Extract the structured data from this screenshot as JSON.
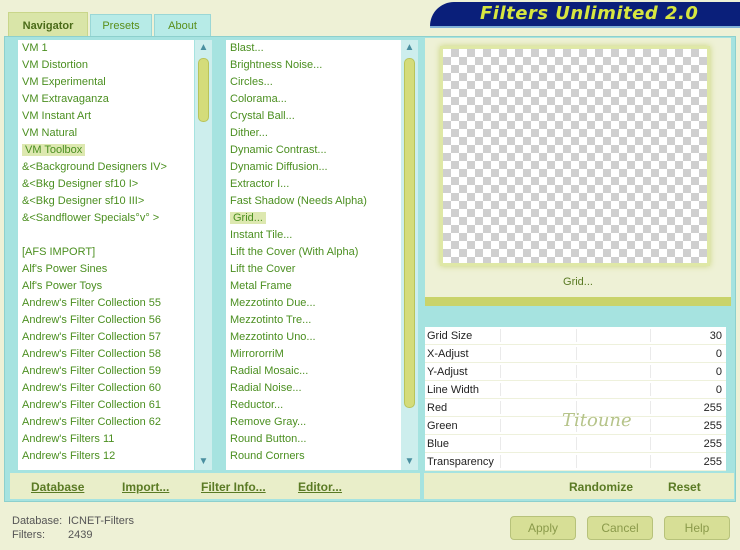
{
  "tabs": [
    {
      "label": "Navigator"
    },
    {
      "label": "Presets"
    },
    {
      "label": "About"
    }
  ],
  "banner": {
    "title": "Filters Unlimited 2.0"
  },
  "categories": {
    "selected_index": 6,
    "items": [
      "VM 1",
      "VM Distortion",
      "VM Experimental",
      "VM Extravaganza",
      "VM Instant Art",
      "VM Natural",
      "VM Toolbox",
      "&<Background Designers IV>",
      "&<Bkg Designer sf10 I>",
      "&<Bkg Designer sf10 III>",
      "&<Sandflower Specials°v° >",
      "",
      "[AFS IMPORT]",
      "Alf's Power Sines",
      "Alf's Power Toys",
      "Andrew's Filter Collection 55",
      "Andrew's Filter Collection 56",
      "Andrew's Filter Collection 57",
      "Andrew's Filter Collection 58",
      "Andrew's Filter Collection 59",
      "Andrew's Filter Collection 60",
      "Andrew's Filter Collection 61",
      "Andrew's Filter Collection 62",
      "Andrew's Filters 11",
      "Andrew's Filters 12"
    ]
  },
  "filters": {
    "selected_index": 10,
    "items": [
      "Blast...",
      "Brightness Noise...",
      "Circles...",
      "Colorama...",
      "Crystal Ball...",
      "Dither...",
      "Dynamic Contrast...",
      "Dynamic Diffusion...",
      "Extractor I...",
      "Fast Shadow (Needs Alpha)",
      "Grid...",
      "Instant Tile...",
      "Lift the Cover (With Alpha)",
      "Lift the Cover",
      "Metal Frame",
      "Mezzotinto Due...",
      "Mezzotinto Tre...",
      "Mezzotinto Uno...",
      "MirrororriM",
      "Radial Mosaic...",
      "Radial Noise...",
      "Reductor...",
      "Remove Gray...",
      "Round Button...",
      "Round Corners"
    ]
  },
  "preview": {
    "filter_name": "Grid..."
  },
  "parameters": [
    {
      "label": "Grid Size",
      "value": "30"
    },
    {
      "label": "X-Adjust",
      "value": "0"
    },
    {
      "label": "Y-Adjust",
      "value": "0"
    },
    {
      "label": "Line Width",
      "value": "0"
    },
    {
      "label": "Red",
      "value": "255"
    },
    {
      "label": "Green",
      "value": "255"
    },
    {
      "label": "Blue",
      "value": "255"
    },
    {
      "label": "Transparency",
      "value": "255"
    }
  ],
  "watermark": "Titoune",
  "toolbar": {
    "database": "Database",
    "import": "Import...",
    "filter_info": "Filter Info...",
    "editor": "Editor...",
    "randomize": "Randomize",
    "reset": "Reset"
  },
  "footer": {
    "database_label": "Database:",
    "database_value": "ICNET-Filters",
    "filters_label": "Filters:",
    "filters_value": "2439",
    "apply": "Apply",
    "cancel": "Cancel",
    "help": "Help"
  },
  "colors": {
    "accent": "#0a1f7a",
    "banner_text": "#d7e640",
    "list_text": "#4b8f20",
    "frame": "#a6e3e0"
  }
}
